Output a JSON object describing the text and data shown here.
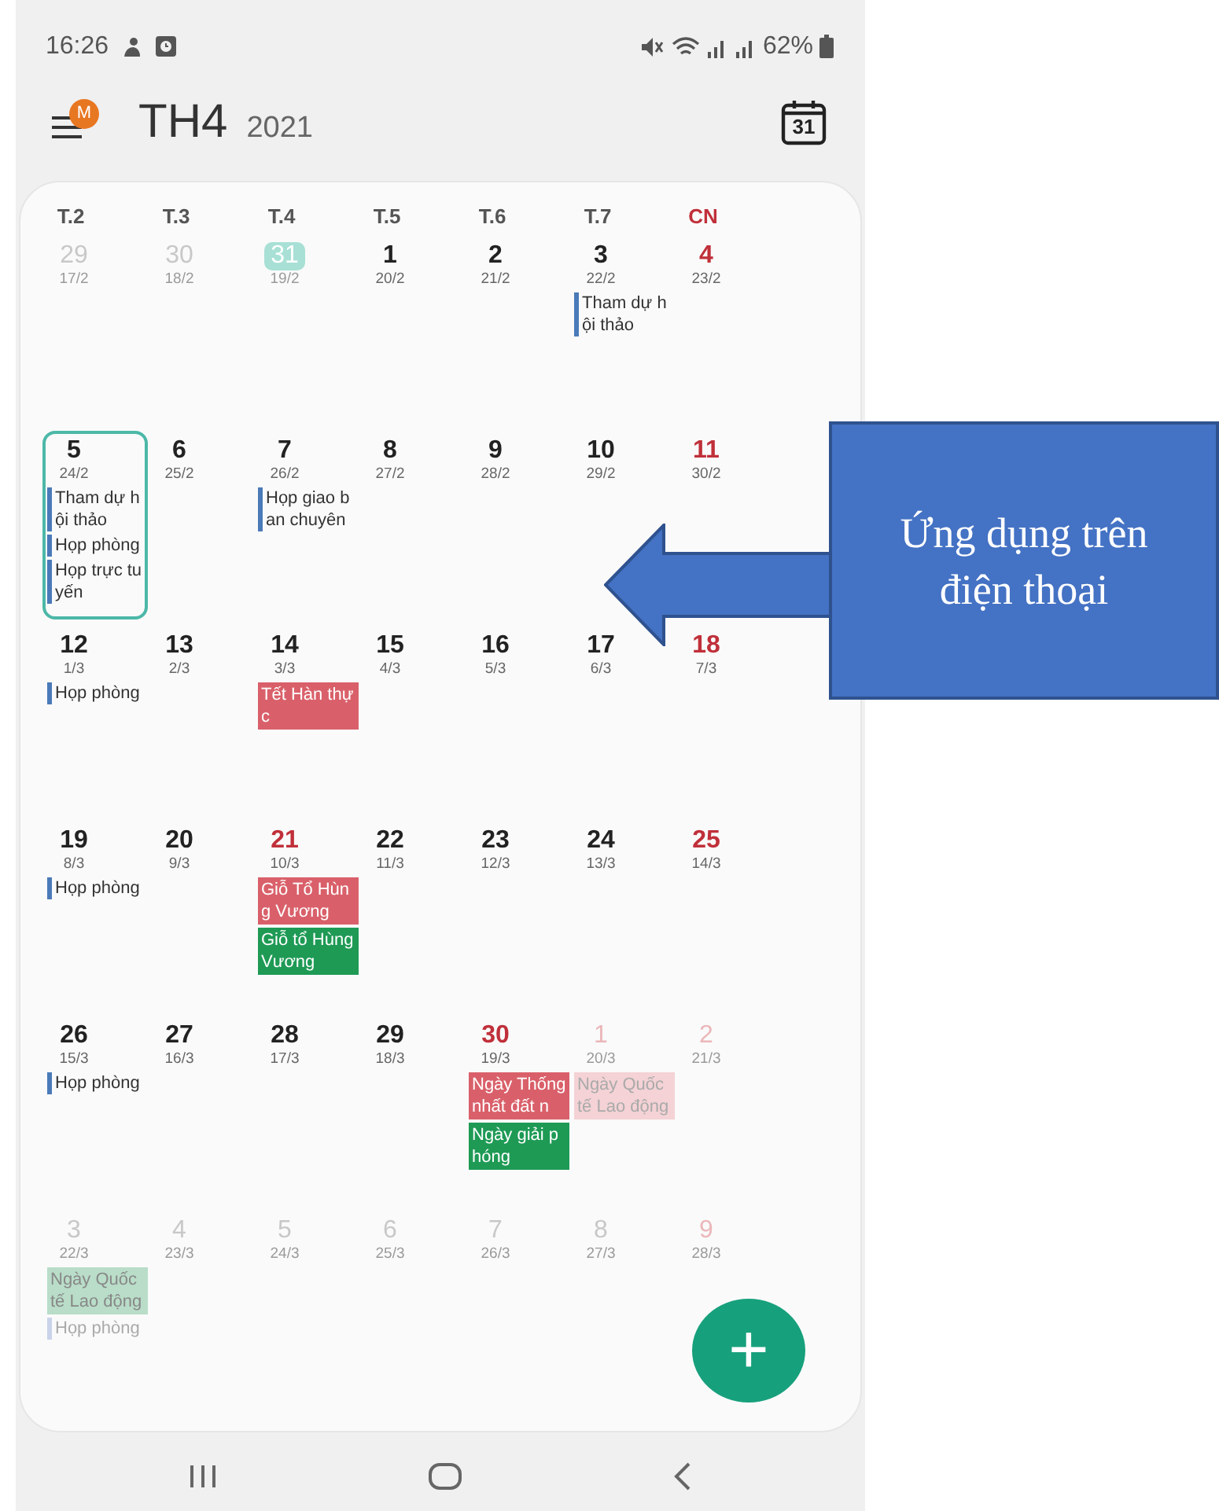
{
  "status_bar": {
    "time": "16:26",
    "battery": "62%"
  },
  "header": {
    "badge": "M",
    "month": "TH4",
    "year": "2021",
    "today_icon": "31"
  },
  "weekdays": [
    {
      "label": "T.2",
      "red": false
    },
    {
      "label": "T.3",
      "red": false
    },
    {
      "label": "T.4",
      "red": false
    },
    {
      "label": "T.5",
      "red": false
    },
    {
      "label": "T.6",
      "red": false
    },
    {
      "label": "T.7",
      "red": false
    },
    {
      "label": "CN",
      "red": true
    }
  ],
  "weeks": [
    [
      {
        "date": "29",
        "lunar": "17/2",
        "muted": true,
        "red": false,
        "today": false,
        "selected": false
      },
      {
        "date": "30",
        "lunar": "18/2",
        "muted": true,
        "red": false,
        "today": false,
        "selected": false
      },
      {
        "date": "31",
        "lunar": "19/2",
        "muted": true,
        "red": false,
        "today": true,
        "selected": false
      },
      {
        "date": "1",
        "lunar": "20/2",
        "muted": false,
        "red": false,
        "today": false,
        "selected": false
      },
      {
        "date": "2",
        "lunar": "21/2",
        "muted": false,
        "red": false,
        "today": false,
        "selected": false
      },
      {
        "date": "3",
        "lunar": "22/2",
        "muted": false,
        "red": false,
        "today": false,
        "selected": false,
        "events": [
          {
            "title": "Tham dự hội thảo",
            "kind": "task",
            "muted": false
          }
        ]
      },
      {
        "date": "4",
        "lunar": "23/2",
        "muted": false,
        "red": true,
        "today": false,
        "selected": false
      }
    ],
    [
      {
        "date": "5",
        "lunar": "24/2",
        "muted": false,
        "red": false,
        "today": false,
        "selected": true,
        "events": [
          {
            "title": "Tham dự hội thảo",
            "kind": "task",
            "muted": false
          },
          {
            "title": "Họp phòng",
            "kind": "task",
            "muted": false
          },
          {
            "title": "Họp trực tuyến",
            "kind": "task",
            "muted": false
          }
        ]
      },
      {
        "date": "6",
        "lunar": "25/2",
        "muted": false,
        "red": false,
        "today": false,
        "selected": false
      },
      {
        "date": "7",
        "lunar": "26/2",
        "muted": false,
        "red": false,
        "today": false,
        "selected": false,
        "events": [
          {
            "title": "Họp giao ban chuyên",
            "kind": "task",
            "muted": false
          }
        ]
      },
      {
        "date": "8",
        "lunar": "27/2",
        "muted": false,
        "red": false,
        "today": false,
        "selected": false
      },
      {
        "date": "9",
        "lunar": "28/2",
        "muted": false,
        "red": false,
        "today": false,
        "selected": false
      },
      {
        "date": "10",
        "lunar": "29/2",
        "muted": false,
        "red": false,
        "today": false,
        "selected": false
      },
      {
        "date": "11",
        "lunar": "30/2",
        "muted": false,
        "red": true,
        "today": false,
        "selected": false
      }
    ],
    [
      {
        "date": "12",
        "lunar": "1/3",
        "muted": false,
        "red": false,
        "today": false,
        "selected": false,
        "events": [
          {
            "title": "Họp phòng",
            "kind": "task",
            "muted": false
          }
        ]
      },
      {
        "date": "13",
        "lunar": "2/3",
        "muted": false,
        "red": false,
        "today": false,
        "selected": false
      },
      {
        "date": "14",
        "lunar": "3/3",
        "muted": false,
        "red": false,
        "today": false,
        "selected": false,
        "events": [
          {
            "title": "Tết Hàn thực",
            "kind": "holiday",
            "muted": false
          }
        ]
      },
      {
        "date": "15",
        "lunar": "4/3",
        "muted": false,
        "red": false,
        "today": false,
        "selected": false
      },
      {
        "date": "16",
        "lunar": "5/3",
        "muted": false,
        "red": false,
        "today": false,
        "selected": false
      },
      {
        "date": "17",
        "lunar": "6/3",
        "muted": false,
        "red": false,
        "today": false,
        "selected": false
      },
      {
        "date": "18",
        "lunar": "7/3",
        "muted": false,
        "red": true,
        "today": false,
        "selected": false
      }
    ],
    [
      {
        "date": "19",
        "lunar": "8/3",
        "muted": false,
        "red": false,
        "today": false,
        "selected": false,
        "events": [
          {
            "title": "Họp phòng",
            "kind": "task",
            "muted": false
          }
        ]
      },
      {
        "date": "20",
        "lunar": "9/3",
        "muted": false,
        "red": false,
        "today": false,
        "selected": false
      },
      {
        "date": "21",
        "lunar": "10/3",
        "muted": false,
        "red": true,
        "today": false,
        "selected": false,
        "events": [
          {
            "title": "Giỗ Tổ Hùng Vương",
            "kind": "holiday",
            "muted": false
          },
          {
            "title": "Giỗ tổ Hùng Vương",
            "kind": "observance",
            "muted": false
          }
        ]
      },
      {
        "date": "22",
        "lunar": "11/3",
        "muted": false,
        "red": false,
        "today": false,
        "selected": false
      },
      {
        "date": "23",
        "lunar": "12/3",
        "muted": false,
        "red": false,
        "today": false,
        "selected": false
      },
      {
        "date": "24",
        "lunar": "13/3",
        "muted": false,
        "red": false,
        "today": false,
        "selected": false
      },
      {
        "date": "25",
        "lunar": "14/3",
        "muted": false,
        "red": true,
        "today": false,
        "selected": false
      }
    ],
    [
      {
        "date": "26",
        "lunar": "15/3",
        "muted": false,
        "red": false,
        "today": false,
        "selected": false,
        "events": [
          {
            "title": "Họp phòng",
            "kind": "task",
            "muted": false
          }
        ]
      },
      {
        "date": "27",
        "lunar": "16/3",
        "muted": false,
        "red": false,
        "today": false,
        "selected": false
      },
      {
        "date": "28",
        "lunar": "17/3",
        "muted": false,
        "red": false,
        "today": false,
        "selected": false
      },
      {
        "date": "29",
        "lunar": "18/3",
        "muted": false,
        "red": false,
        "today": false,
        "selected": false
      },
      {
        "date": "30",
        "lunar": "19/3",
        "muted": false,
        "red": true,
        "today": false,
        "selected": false,
        "events": [
          {
            "title": "Ngày Thống nhất đất n",
            "kind": "holiday",
            "muted": false
          },
          {
            "title": "Ngày giải phóng",
            "kind": "observance",
            "muted": false
          }
        ]
      },
      {
        "date": "1",
        "lunar": "20/3",
        "muted": true,
        "red": true,
        "today": false,
        "selected": false,
        "events": [
          {
            "title": "Ngày Quốc tế Lao động",
            "kind": "holiday",
            "muted": true
          }
        ]
      },
      {
        "date": "2",
        "lunar": "21/3",
        "muted": true,
        "red": true,
        "today": false,
        "selected": false
      }
    ],
    [
      {
        "date": "3",
        "lunar": "22/3",
        "muted": true,
        "red": false,
        "today": false,
        "selected": false,
        "events": [
          {
            "title": "Ngày Quốc tế Lao động",
            "kind": "observance",
            "muted": true
          },
          {
            "title": "Họp phòng",
            "kind": "task",
            "muted": true
          }
        ]
      },
      {
        "date": "4",
        "lunar": "23/3",
        "muted": true,
        "red": false,
        "today": false,
        "selected": false
      },
      {
        "date": "5",
        "lunar": "24/3",
        "muted": true,
        "red": false,
        "today": false,
        "selected": false
      },
      {
        "date": "6",
        "lunar": "25/3",
        "muted": true,
        "red": false,
        "today": false,
        "selected": false
      },
      {
        "date": "7",
        "lunar": "26/3",
        "muted": true,
        "red": false,
        "today": false,
        "selected": false
      },
      {
        "date": "8",
        "lunar": "27/3",
        "muted": true,
        "red": false,
        "today": false,
        "selected": false
      },
      {
        "date": "9",
        "lunar": "28/3",
        "muted": true,
        "red": true,
        "today": false,
        "selected": false
      }
    ]
  ],
  "fab": {
    "label": "+"
  },
  "callout": {
    "text": "Ứng dụng trên điện thoại"
  }
}
